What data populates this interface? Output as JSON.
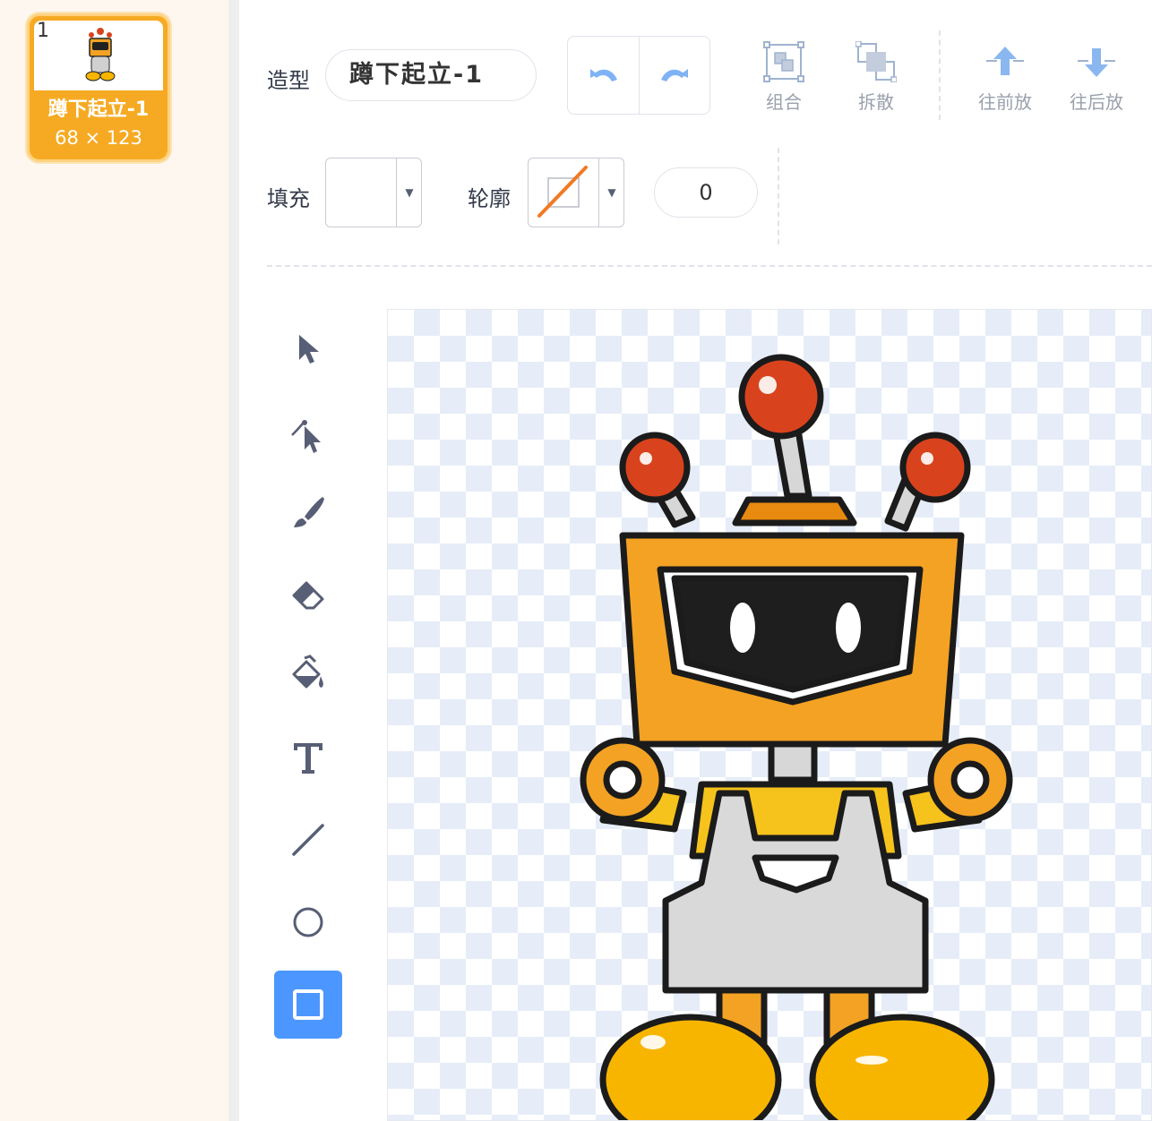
{
  "costume": {
    "index": "1",
    "name": "蹲下起立-1",
    "size": "68 × 123"
  },
  "toolbar": {
    "costume_label": "造型",
    "costume_name_value": "蹲下起立-1",
    "group_label": "组合",
    "ungroup_label": "拆散",
    "forward_label": "往前放",
    "backward_label": "往后放"
  },
  "style_bar": {
    "fill_label": "填充",
    "outline_label": "轮廓",
    "outline_width": "0",
    "outline_color": "#f07a25"
  },
  "tools": [
    {
      "name": "select-tool",
      "icon": "arrow-cursor-icon"
    },
    {
      "name": "reshape-tool",
      "icon": "reshape-cursor-icon"
    },
    {
      "name": "brush-tool",
      "icon": "brush-icon"
    },
    {
      "name": "eraser-tool",
      "icon": "eraser-icon"
    },
    {
      "name": "fill-tool",
      "icon": "paint-bucket-icon"
    },
    {
      "name": "text-tool",
      "icon": "text-T-icon"
    },
    {
      "name": "line-tool",
      "icon": "line-icon"
    },
    {
      "name": "circle-tool",
      "icon": "circle-icon"
    },
    {
      "name": "rectangle-tool",
      "icon": "rectangle-icon",
      "active": true
    }
  ],
  "colors": {
    "accent": "#4c97ff",
    "costume_card": "#f6aa23",
    "robot_orange": "#f3a223",
    "robot_red": "#d8431d"
  }
}
